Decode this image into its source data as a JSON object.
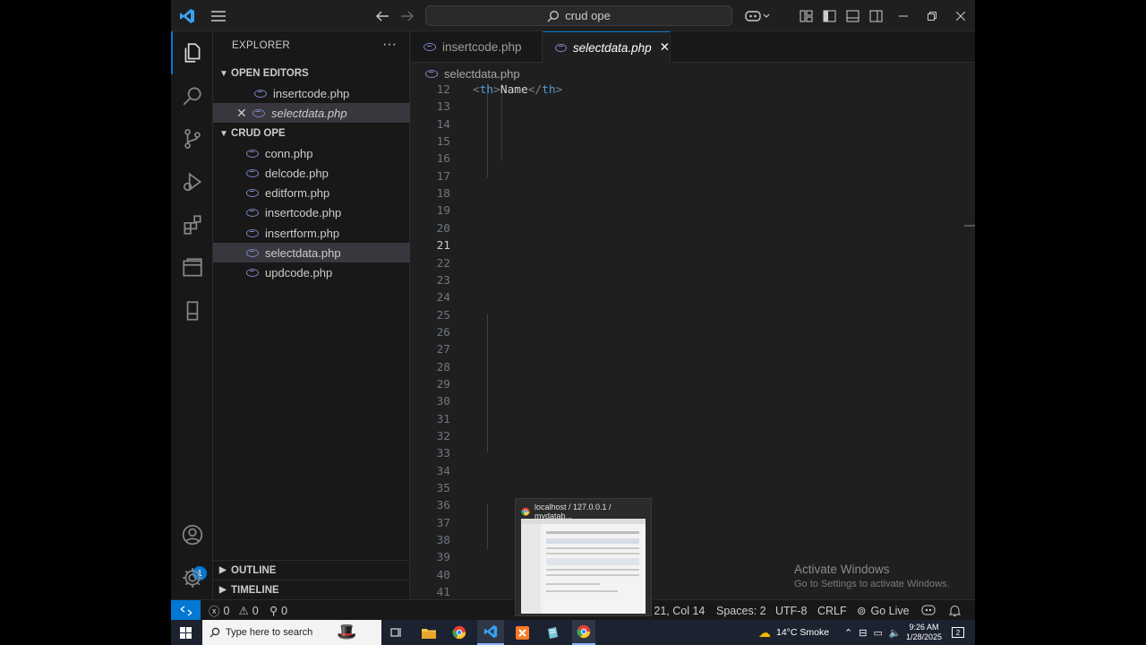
{
  "titlebar": {
    "search_text": "crud ope"
  },
  "activity": {
    "accounts_badge": "1"
  },
  "sidebar": {
    "title": "EXPLORER",
    "more": "···",
    "open_editors_label": "OPEN EDITORS",
    "open_editors": [
      {
        "label": "insertcode.php"
      },
      {
        "label": "selectdata.php"
      }
    ],
    "folder_label": "CRUD OPE",
    "files": [
      {
        "label": "conn.php"
      },
      {
        "label": "delcode.php"
      },
      {
        "label": "editform.php"
      },
      {
        "label": "insertcode.php"
      },
      {
        "label": "insertform.php"
      },
      {
        "label": "selectdata.php"
      },
      {
        "label": "updcode.php"
      }
    ],
    "outline_label": "OUTLINE",
    "timeline_label": "TIMELINE"
  },
  "tabs": [
    {
      "label": "insertcode.php"
    },
    {
      "label": "selectdata.php"
    }
  ],
  "breadcrumb": "selectdata.php",
  "editor": {
    "line_numbers": [
      "12",
      "13",
      "14",
      "15",
      "16",
      "17",
      "18",
      "19",
      "20",
      "21",
      "22",
      "23",
      "24",
      "25",
      "26",
      "27",
      "28",
      "29",
      "30",
      "31",
      "32",
      "33",
      "34",
      "35",
      "36",
      "37",
      "38",
      "39",
      "40",
      "41"
    ],
    "current_line": "21"
  },
  "watermark": {
    "title": "Activate Windows",
    "subtitle": "Go to Settings to activate Windows."
  },
  "statusbar": {
    "errors": "0",
    "warnings": "0",
    "ports": "0",
    "position": "Ln 21, Col 14",
    "spaces": "Spaces: 2",
    "encoding": "UTF-8",
    "eol": "CRLF",
    "golive": "Go Live"
  },
  "popup": {
    "title": "localhost / 127.0.0.1 / mydatab..."
  },
  "taskbar": {
    "search_placeholder": "Type here to search",
    "weather": "14°C  Smoke",
    "time": "9:26 AM",
    "date": "1/28/2025",
    "notifications": "2"
  },
  "colors": {
    "accent": "#0078d4",
    "keyword": "#569cd6",
    "control": "#c586c0",
    "string": "#ce9178",
    "variable": "#9cdcfe",
    "function": "#dcdcaa",
    "tag_bracket": "#808080"
  }
}
